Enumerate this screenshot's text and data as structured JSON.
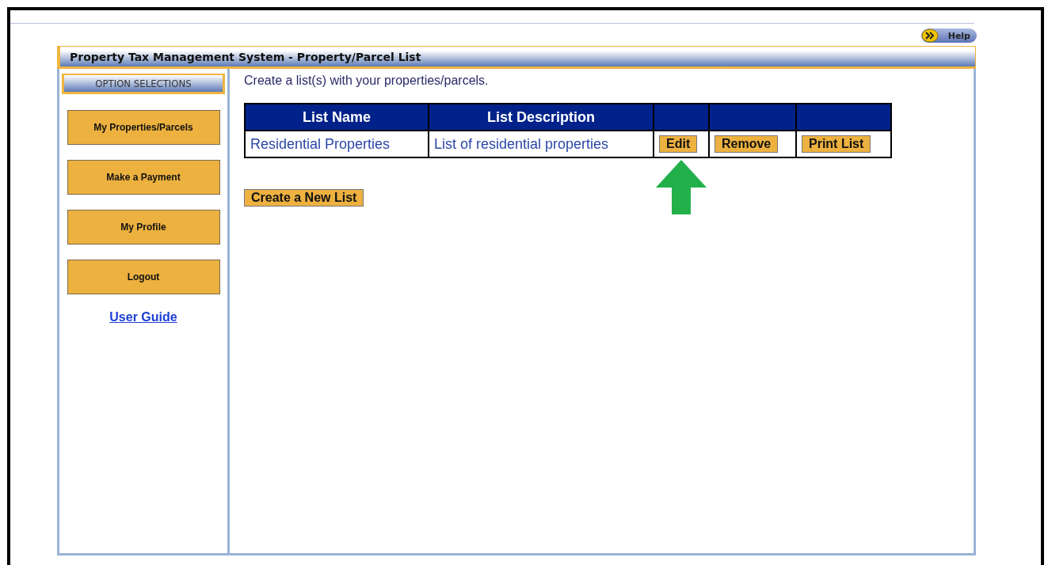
{
  "help_button": {
    "label": "Help"
  },
  "window": {
    "title": "Property Tax Management System - Property/Parcel List"
  },
  "sidebar": {
    "heading": "OPTION SELECTIONS",
    "items": [
      {
        "label": "My Properties/Parcels"
      },
      {
        "label": "Make a Payment"
      },
      {
        "label": "My Profile"
      },
      {
        "label": "Logout"
      }
    ],
    "link": "User Guide"
  },
  "intro": "Create a list(s) with your properties/parcels.",
  "table": {
    "columns": [
      "List Name",
      "List Description"
    ],
    "rows": [
      {
        "name": "Residential Properties",
        "description": "List of residential properties",
        "actions": [
          {
            "label": "Edit",
            "arrow": true
          },
          {
            "label": "Remove",
            "arrow": false
          },
          {
            "label": "Print List",
            "arrow": false
          }
        ]
      }
    ]
  },
  "create_button": {
    "label": "Create a New List"
  }
}
